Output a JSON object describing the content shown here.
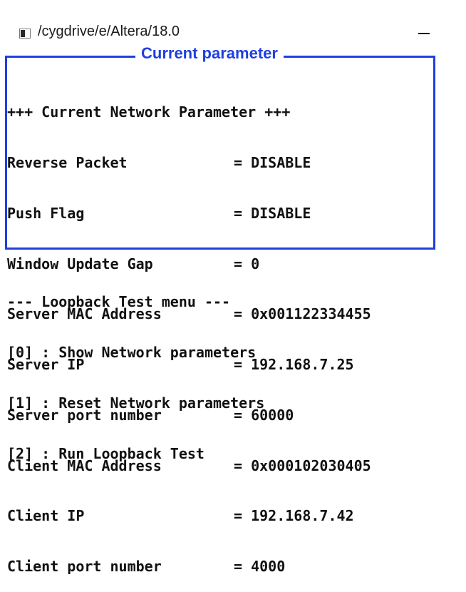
{
  "window": {
    "title": "/cygdrive/e/Altera/18.0",
    "minimize_symbol": "—"
  },
  "param_box": {
    "label": "Current parameter",
    "header": "+++ Current Network Parameter +++",
    "rows": [
      {
        "key": "Reverse Packet",
        "value": "= DISABLE"
      },
      {
        "key": "Push Flag",
        "value": "= DISABLE"
      },
      {
        "key": "Window Update Gap",
        "value": "= 0"
      },
      {
        "key": "Server MAC Address",
        "value": "= 0x001122334455"
      },
      {
        "key": "Server IP",
        "value": "= 192.168.7.25"
      },
      {
        "key": "Server port number",
        "value": "= 60000"
      },
      {
        "key": "Client MAC Address",
        "value": "= 0x000102030405"
      },
      {
        "key": "Client IP",
        "value": "= 192.168.7.42"
      },
      {
        "key": "Client port number",
        "value": "= 4000"
      }
    ]
  },
  "menu": {
    "title": "--- Loopback Test menu ---",
    "items": [
      "[0] : Show Network parameters",
      "[1] : Reset Network parameters",
      "[2] : Run Loopback Test"
    ]
  }
}
